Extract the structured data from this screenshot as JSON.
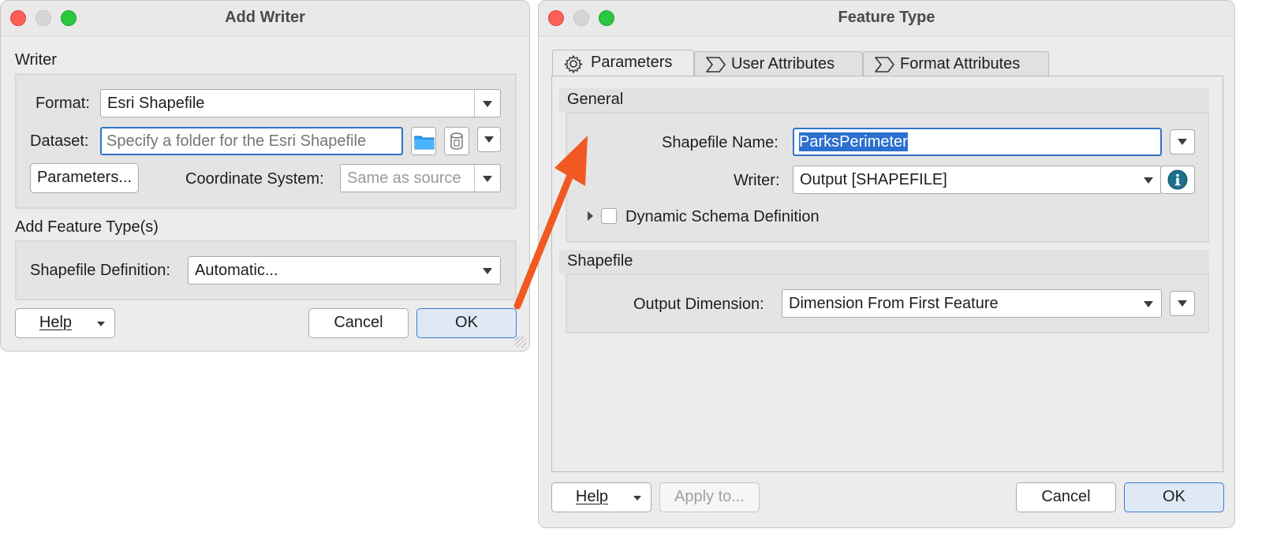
{
  "add_writer": {
    "title": "Add Writer",
    "writer_section": "Writer",
    "format_label": "Format:",
    "format_value": "Esri Shapefile",
    "dataset_label": "Dataset:",
    "dataset_placeholder": "Specify a folder for the Esri Shapefile",
    "parameters_button": "Parameters...",
    "coord_label": "Coordinate System:",
    "coord_value": "Same as source",
    "feature_section": "Add Feature Type(s)",
    "shapefile_def_label": "Shapefile Definition:",
    "shapefile_def_value": "Automatic...",
    "help_button": "Help",
    "cancel_button": "Cancel",
    "ok_button": "OK"
  },
  "feature_type": {
    "title": "Feature Type",
    "tabs": [
      {
        "label": "Parameters",
        "icon": "gear-icon"
      },
      {
        "label": "User Attributes",
        "icon": "sigma-icon"
      },
      {
        "label": "Format Attributes",
        "icon": "sigma-icon"
      }
    ],
    "general_section": "General",
    "shapefile_name_label": "Shapefile Name:",
    "shapefile_name_value": "ParksPerimeter",
    "writer_label": "Writer:",
    "writer_value": "Output [SHAPEFILE]",
    "dynamic_schema_label": "Dynamic Schema Definition",
    "shapefile_section": "Shapefile",
    "output_dim_label": "Output Dimension:",
    "output_dim_value": "Dimension From First Feature",
    "help_button": "Help",
    "apply_button": "Apply to...",
    "cancel_button": "Cancel",
    "ok_button": "OK"
  },
  "colors": {
    "arrow": "#f05a22",
    "accent": "#2f74c8",
    "info": "#1e6f8c"
  }
}
